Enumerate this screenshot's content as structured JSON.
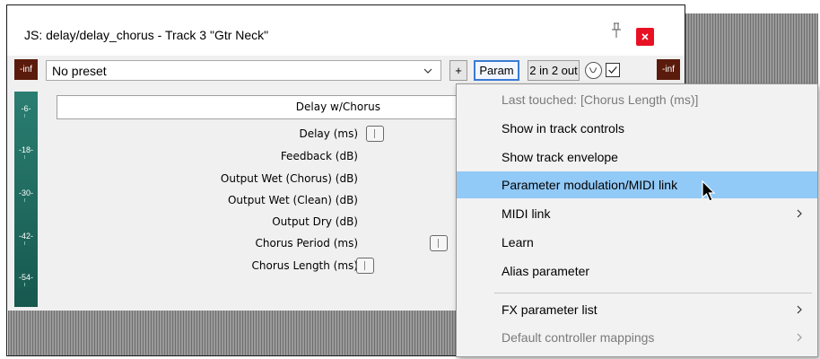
{
  "window": {
    "title": "JS: delay/delay_chorus - Track 3 \"Gtr Neck\""
  },
  "toolbar": {
    "vu_left": "-inf",
    "vu_right": "-inf",
    "preset_value": "No preset",
    "plus_label": "+",
    "param_label": "Param",
    "io_label": "2 in 2 out",
    "enabled_checked": true
  },
  "meter": {
    "ticks": [
      "-6-",
      "-18-",
      "-30-",
      "-42-",
      "-54-"
    ]
  },
  "plugin": {
    "name": "Delay w/Chorus",
    "params": [
      {
        "label": "Delay (ms)",
        "level": 0.0
      },
      {
        "label": "Feedback (dB)"
      },
      {
        "label": "Output Wet (Chorus) (dB)"
      },
      {
        "label": "Output Wet (Clean) (dB)"
      },
      {
        "label": "Output Dry (dB)"
      },
      {
        "label": "Chorus Period (ms)"
      },
      {
        "label": "Chorus Length (ms)"
      }
    ]
  },
  "menu": {
    "items": [
      {
        "label": "Last touched: [Chorus Length (ms)]",
        "disabled": true,
        "submenu": false
      },
      {
        "label": "Show in track controls",
        "disabled": false,
        "submenu": false
      },
      {
        "label": "Show track envelope",
        "disabled": false,
        "submenu": false
      },
      {
        "label": "Parameter modulation/MIDI link",
        "disabled": false,
        "submenu": false,
        "highlighted": true
      },
      {
        "label": "MIDI link",
        "disabled": false,
        "submenu": true
      },
      {
        "label": "Learn",
        "disabled": false,
        "submenu": false
      },
      {
        "label": "Alias parameter",
        "disabled": false,
        "submenu": false
      },
      {
        "label": "FX parameter list",
        "disabled": false,
        "submenu": true
      },
      {
        "label": "Default controller mappings",
        "disabled": true,
        "submenu": true
      }
    ]
  },
  "colors": {
    "close_button": "#e81123",
    "vu_cap": "#5b1b0c",
    "meter_top": "#2a7e71",
    "meter_bottom": "#17584f",
    "menu_highlight": "#91c9f7",
    "param_button_border": "#3a7bd5"
  },
  "icons": {
    "pin": "pin-icon",
    "close": "close-icon",
    "dropdown": "chevron-down-icon",
    "knob": "knob-icon",
    "check": "check-icon",
    "submenu": "chevron-right-icon",
    "cursor": "mouse-cursor-icon"
  }
}
